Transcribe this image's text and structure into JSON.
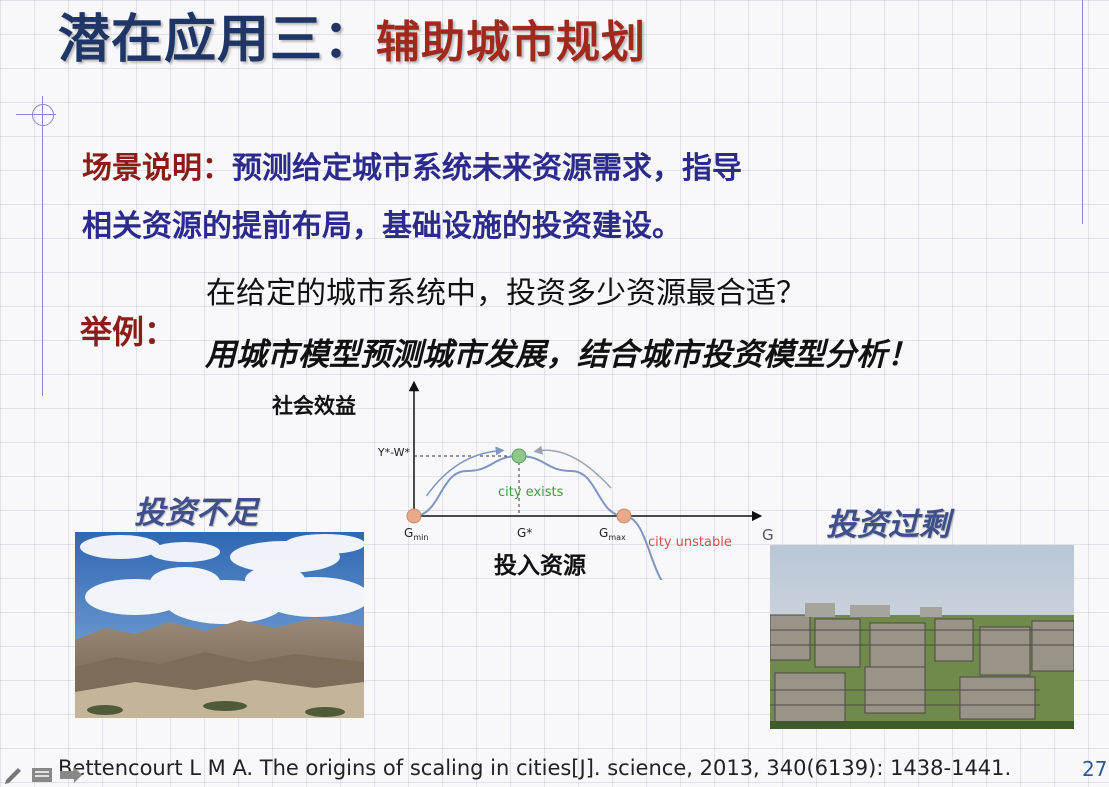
{
  "title": {
    "part1": "潜在应用三：",
    "part2": "辅助城市规划"
  },
  "scene": {
    "label": "场景说明：",
    "line1": "预测给定城市系统未来资源需求，指导",
    "line2": "相关资源的提前布局，基础设施的投资建设。"
  },
  "example": {
    "label": "举例：",
    "question": "在给定的城市系统中，投资多少资源最合适？",
    "answer": "用城市模型预测城市发展，结合城市投资模型分析！"
  },
  "left_label": "投资不足",
  "right_label": "投资过剩",
  "chart": {
    "y_label": "社会效益",
    "x_label": "投入资源",
    "y_tick": "Y*-W*",
    "x_axis_symbol": "G",
    "g_min": {
      "main": "G",
      "sub": "min"
    },
    "g_star": "G*",
    "g_max": {
      "main": "G",
      "sub": "max"
    },
    "annot_exists": "city exists",
    "annot_unstable": "city unstable"
  },
  "chart_data": {
    "type": "line",
    "title": "",
    "xlabel": "投入资源",
    "ylabel": "社会效益",
    "x_ticks": [
      "Gmin",
      "G*",
      "Gmax"
    ],
    "y_ticks": [
      "Y*-W*"
    ],
    "annotations": [
      "city exists",
      "city unstable"
    ],
    "series": [
      {
        "x": [
          0,
          0.25,
          0.5,
          0.75,
          1.0,
          1.25
        ],
        "y": [
          0,
          0.75,
          1,
          0.75,
          0,
          -1.25
        ]
      }
    ],
    "grid": false
  },
  "reference": "Bettencourt L M A. The origins of scaling in cities[J]. science, 2013, 340(6139): 1438-1441.",
  "page_number": "27",
  "colors": {
    "title_blue": "#1f3566",
    "title_red": "#a0281c",
    "scene_blue": "#2c2a8c",
    "label_red": "#8b1d18",
    "curve": "#7f96c0",
    "green_point": "#8fc78f",
    "red_point": "#e9a98a",
    "annot_green": "#3e9a3e",
    "annot_red": "#d45050"
  }
}
